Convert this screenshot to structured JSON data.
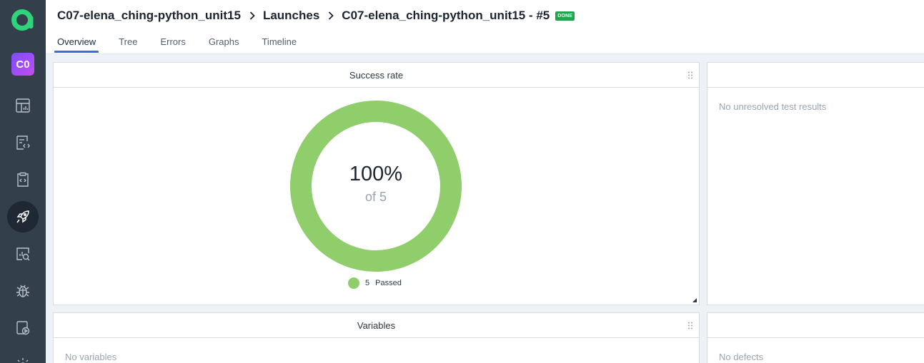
{
  "sidebar": {
    "project_badge": "C0",
    "items": [
      {
        "icon": "dashboard-icon",
        "active": false
      },
      {
        "icon": "test-cases-icon",
        "active": false
      },
      {
        "icon": "test-plans-icon",
        "active": false
      },
      {
        "icon": "launches-rocket-icon",
        "active": true
      },
      {
        "icon": "analytics-icon",
        "active": false
      },
      {
        "icon": "defects-bug-icon",
        "active": false
      },
      {
        "icon": "jobs-play-icon",
        "active": false
      },
      {
        "icon": "settings-gear-icon",
        "active": false
      }
    ]
  },
  "header": {
    "breadcrumb": {
      "project": "C07-elena_ching-python_unit15",
      "section": "Launches",
      "launch": "C07-elena_ching-python_unit15 - #5",
      "status": "DONE"
    },
    "tabs": [
      "Overview",
      "Tree",
      "Errors",
      "Graphs",
      "Timeline"
    ],
    "active_tab": "Overview"
  },
  "widgets": {
    "success_rate": {
      "title": "Success rate",
      "percent_label": "100%",
      "of_label": "of 5",
      "legend_count": "5",
      "legend_label": "Passed",
      "passed_fraction": 1.0,
      "color": "#8fce6a"
    },
    "unresolved": {
      "empty_text": "No unresolved test results"
    },
    "variables": {
      "title": "Variables",
      "empty_text": "No variables"
    },
    "defects": {
      "empty_text": "No defects"
    }
  },
  "colors": {
    "sidebar_bg": "#343f4c",
    "accent": "#3f6ad8",
    "done_badge": "#1fa64a",
    "passed": "#8fce6a"
  }
}
